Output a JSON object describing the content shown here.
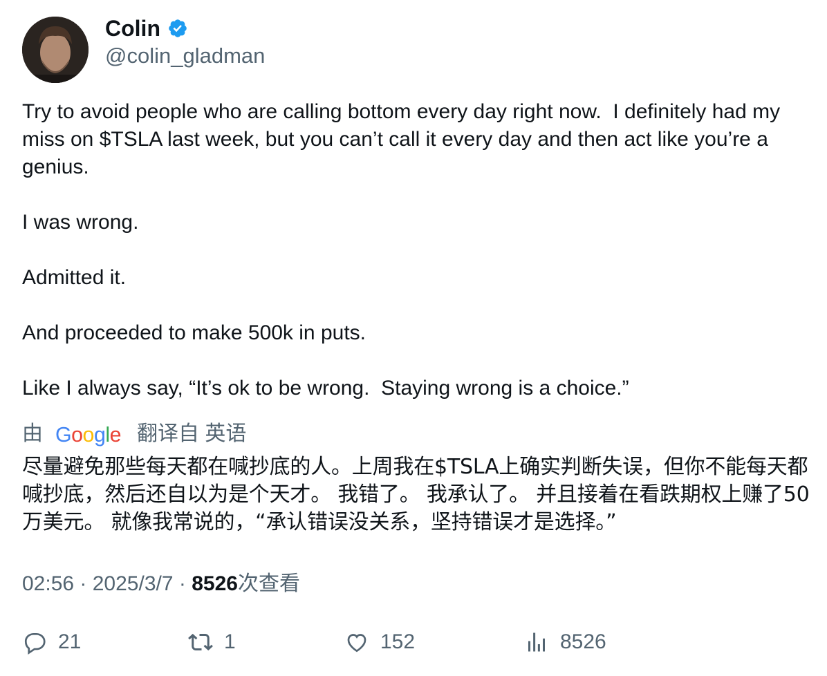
{
  "author": {
    "name": "Colin",
    "handle": "@colin_gladman",
    "verified_icon": "verified-badge-icon",
    "verified_color": "#1d9bf0"
  },
  "tweet": {
    "text": "Try to avoid people who are calling bottom every day right now.  I definitely had my miss on $TSLA last week, but you can’t call it every day and then act like you’re a genius.\n\nI was wrong.\n\nAdmitted it.\n\nAnd proceeded to make 500k in puts.\n\nLike I always say, “It’s ok to be wrong.  Staying wrong is a choice.”"
  },
  "translation": {
    "by_label": "由",
    "provider": "Google",
    "from_label": "翻译自 英语",
    "text": "尽量避免那些每天都在喊抄底的人。上周我在$TSLA上确实判断失误，但你不能每天都喊抄底，然后还自以为是个天才。 我错了。 我承认了。 并且接着在看跌期权上赚了50万美元。 就像我常说的，“承认错误没关系，坚持错误才是选择。”"
  },
  "meta": {
    "time": "02:56",
    "date": "2025/3/7",
    "views_count": "8526",
    "views_label": "次查看"
  },
  "actions": {
    "replies": "21",
    "reposts": "1",
    "likes": "152",
    "views": "8526"
  }
}
